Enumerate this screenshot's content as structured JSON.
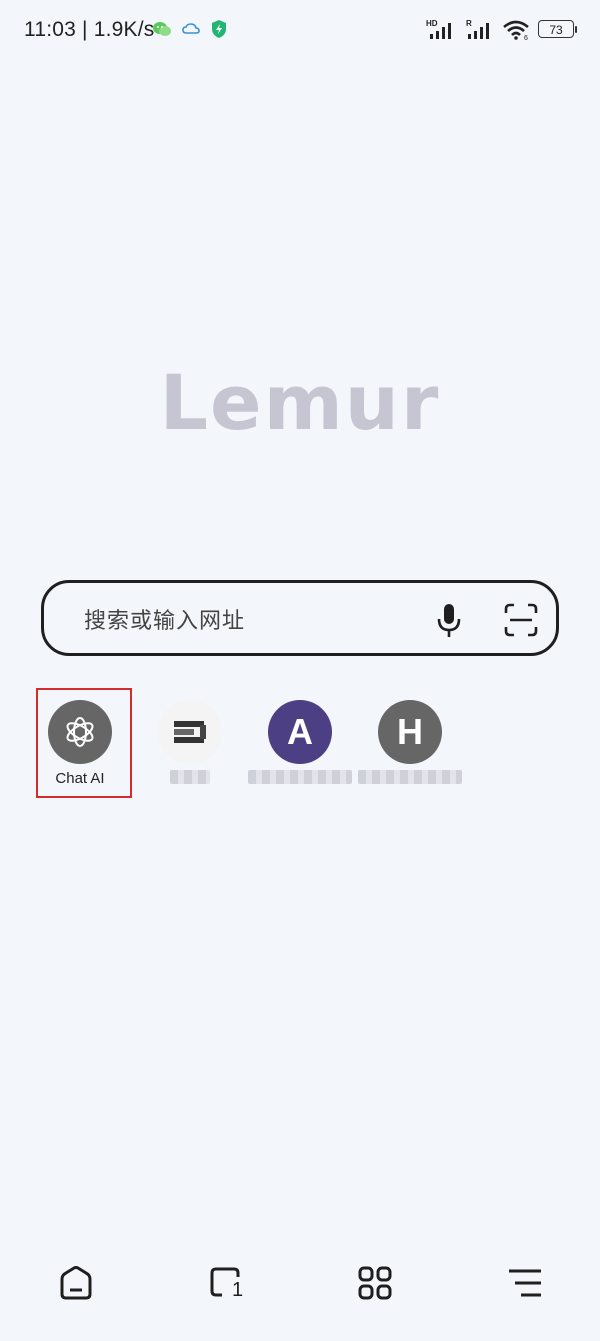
{
  "status": {
    "time": "11:03 | 1.9K/s",
    "battery": "73",
    "network_marks": [
      "HD",
      "R"
    ]
  },
  "logo": "Lemur",
  "search": {
    "placeholder": "搜索或输入网址"
  },
  "shortcuts": [
    {
      "label": "Chat AI",
      "icon": "openai-icon",
      "color": "#666666"
    },
    {
      "label": "",
      "icon": "blurred-site-icon",
      "color": "#333333"
    },
    {
      "label": "",
      "icon": "letter-a-icon",
      "color": "#4d3f84",
      "letter": "A"
    },
    {
      "label": "",
      "icon": "letter-h-icon",
      "color": "#666666",
      "letter": "H"
    }
  ],
  "bottom_nav": [
    "home-icon",
    "tabs-icon",
    "apps-icon",
    "menu-icon"
  ],
  "tab_count": "1"
}
